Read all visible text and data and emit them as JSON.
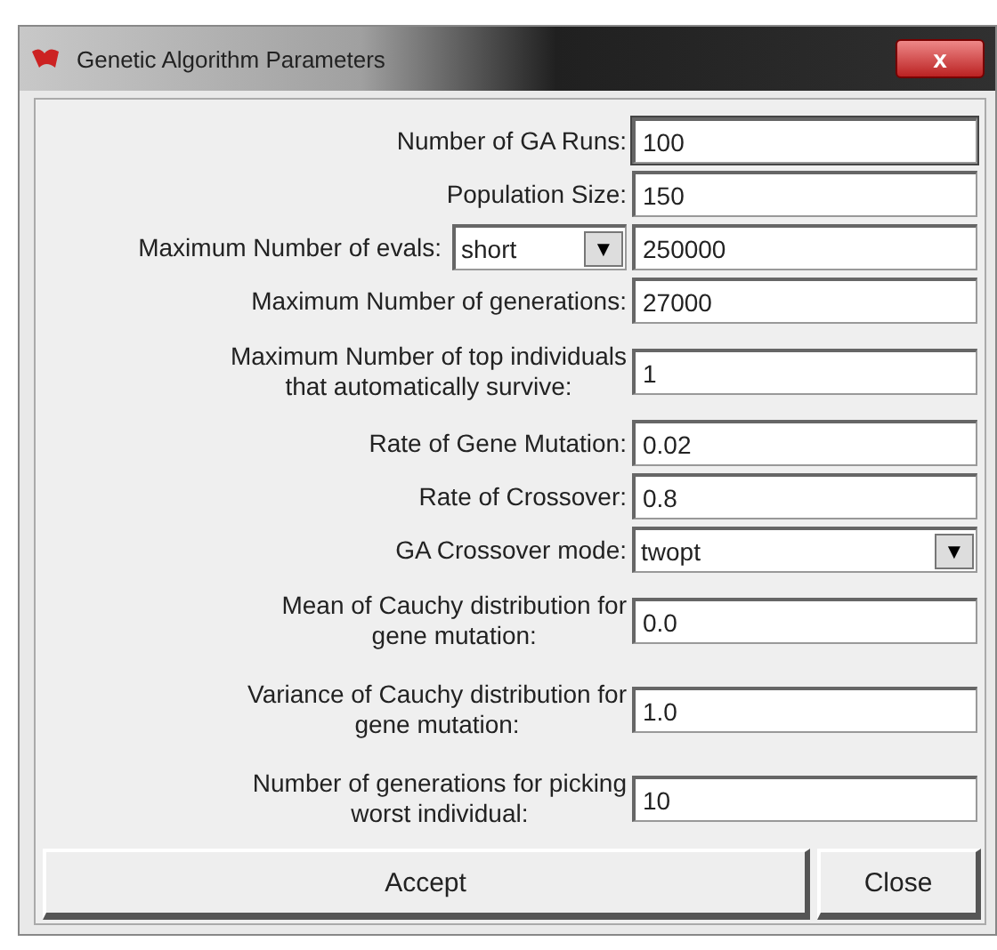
{
  "window": {
    "title": "Genetic Algorithm Parameters",
    "close": "x"
  },
  "rows": [
    {
      "kind": "text",
      "label": "Number of GA Runs:",
      "value": "100",
      "focused": true
    },
    {
      "kind": "text",
      "label": "Population Size:",
      "value": "150",
      "focused": false
    },
    {
      "kind": "select-text",
      "label": "Maximum Number of evals:",
      "select": "short",
      "arrow": "▼",
      "value": "250000",
      "focused": false
    },
    {
      "kind": "text",
      "label": "Maximum Number of generations:",
      "value": "27000",
      "focused": false
    },
    {
      "kind": "text",
      "label": "Maximum Number of top individuals\nthat automatically survive:",
      "value": "1",
      "focused": false
    },
    {
      "kind": "text",
      "label": "Rate of Gene Mutation:",
      "value": "0.02",
      "focused": false
    },
    {
      "kind": "text",
      "label": "Rate of Crossover:",
      "value": "0.8",
      "focused": false
    },
    {
      "kind": "select",
      "label": "GA Crossover mode:",
      "select": "twopt",
      "arrow": "▼"
    },
    {
      "kind": "text",
      "label": "Mean of Cauchy distribution for\ngene mutation:",
      "value": "0.0",
      "focused": false
    },
    {
      "kind": "text",
      "label": "Variance of Cauchy distribution for\ngene mutation:",
      "value": "1.0",
      "focused": false
    },
    {
      "kind": "text",
      "label": "Number of generations for picking\nworst individual:",
      "value": "10",
      "focused": false
    }
  ],
  "buttons": [
    "Accept",
    "Close"
  ]
}
